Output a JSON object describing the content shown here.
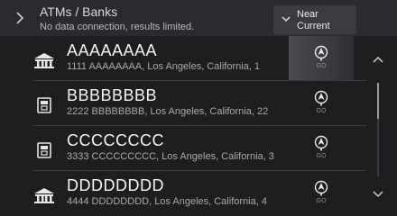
{
  "header": {
    "title": "ATMs / Banks",
    "subtitle": "No data connection, results limited.",
    "back_icon": "chevron-right-icon",
    "sort_button": {
      "label_line1": "Near",
      "label_line2": "Current",
      "icon": "chevron-down-icon"
    }
  },
  "results": [
    {
      "name": "AAAAAAAA",
      "address": "1111 AAAAAAAA, Los Angeles, California, 1",
      "icon": "bank-icon",
      "go_label": "GO"
    },
    {
      "name": "BBBBBBBB",
      "address": "2222 BBBBBBBB, Los Angeles, California, 22",
      "icon": "atm-icon",
      "go_label": "GO"
    },
    {
      "name": "CCCCCCCC",
      "address": "3333 CCCCCCCCC, Los Angeles, California, 3",
      "icon": "atm-icon",
      "go_label": "GO"
    },
    {
      "name": "DDDDDDDD",
      "address": "4444 DDDDDDDD, Los Angeles, California, 4",
      "icon": "bank-icon",
      "go_label": "GO"
    }
  ],
  "scrollbar": {
    "up_icon": "chevron-up-icon",
    "down_icon": "chevron-down-icon"
  },
  "colors": {
    "background": "#1d1e20",
    "header": "#2a2b2e",
    "accent_active_go": "#4a4b4f"
  }
}
